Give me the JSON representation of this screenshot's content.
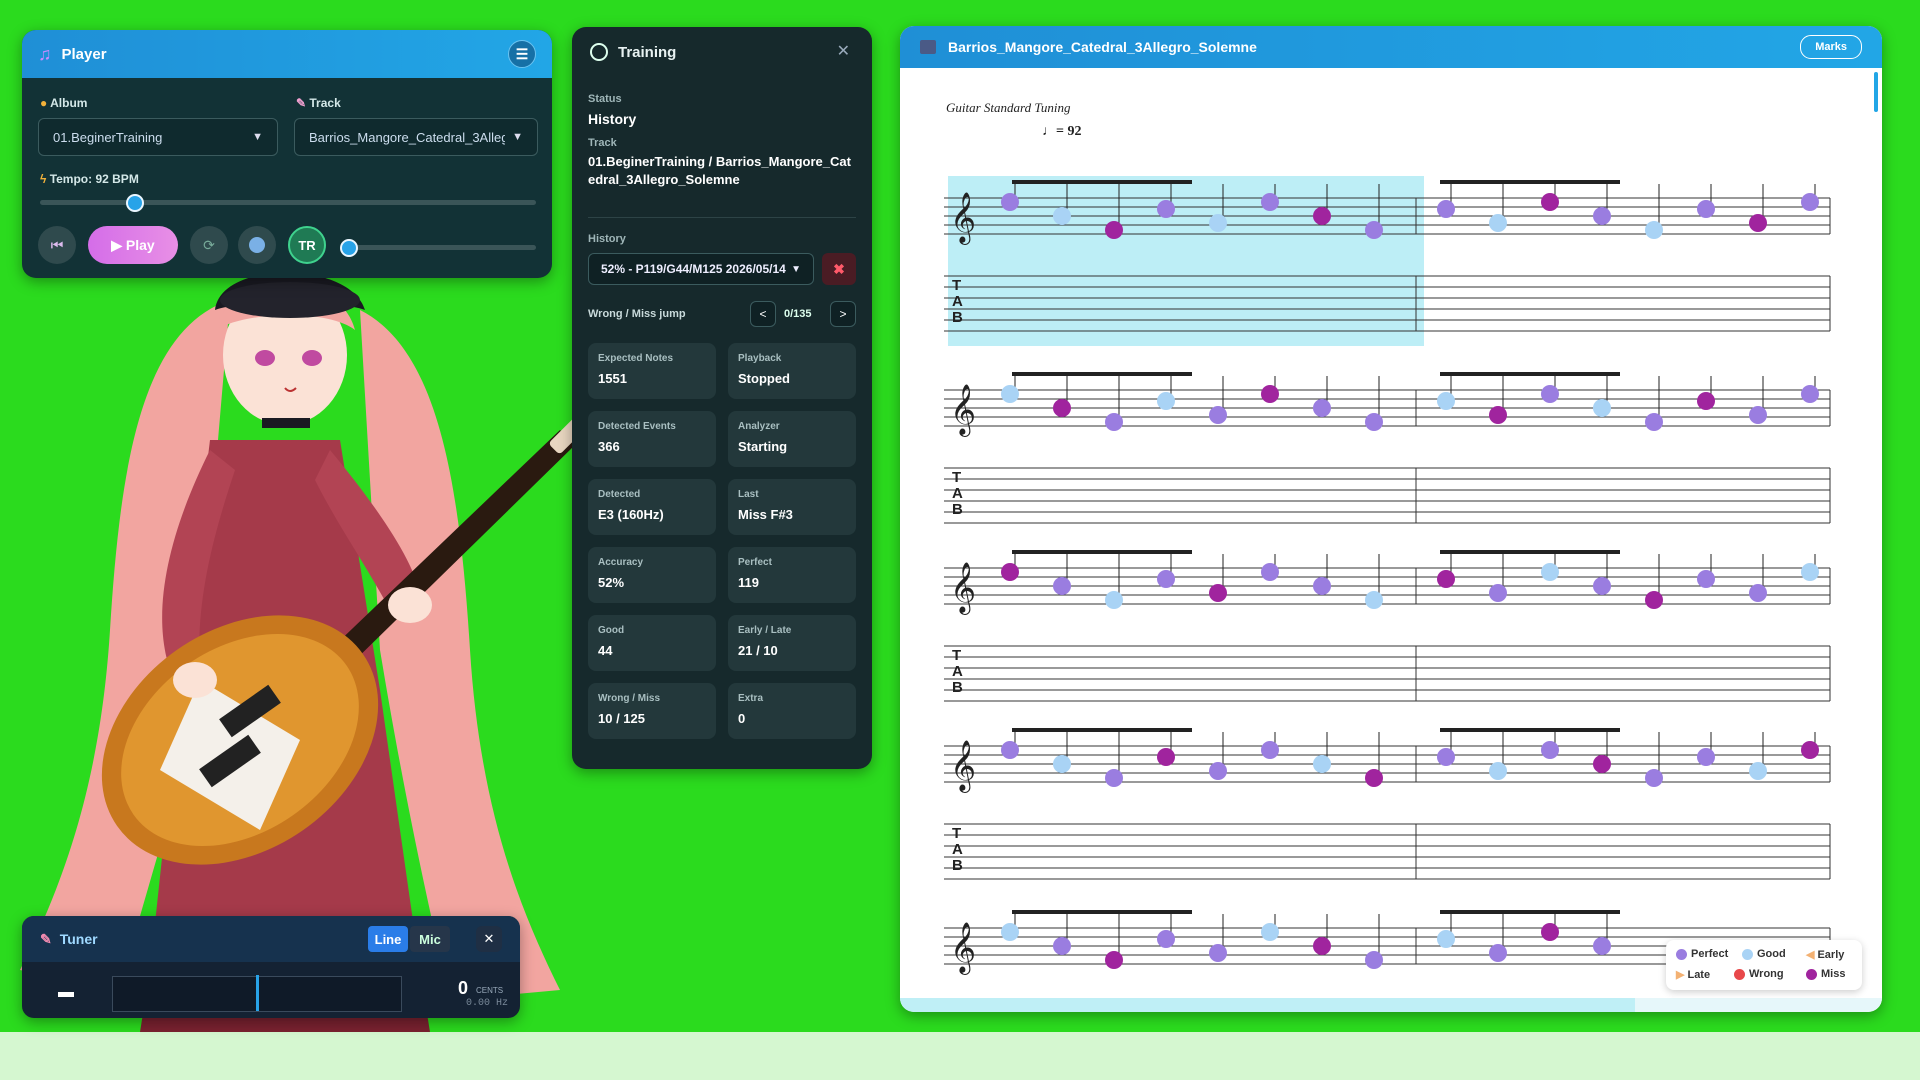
{
  "player": {
    "title": "Player",
    "album_label": "Album",
    "track_label": "Track",
    "album_value": "01.BeginerTraining",
    "track_value": "Barrios_Mangore_Catedral_3Allegro_Solemne",
    "tempo_label": "Tempo: 92 BPM",
    "tempo_slider_value": 92,
    "play_label": "▶ Play",
    "tr_label": "TR"
  },
  "training": {
    "title": "Training",
    "status_label": "Status",
    "status_value": "History",
    "track_label": "Track",
    "track_value": "01.BeginerTraining / Barrios_Mangore_Catedral_3Allegro_Solemne",
    "history_label": "History",
    "history_value": "52% - P119/G44/M125 2026/05/14",
    "jump_label": "Wrong / Miss jump",
    "jump_counter": "0/135",
    "stats": [
      {
        "label": "Expected Notes",
        "value": "1551"
      },
      {
        "label": "Playback",
        "value": "Stopped"
      },
      {
        "label": "Detected Events",
        "value": "366"
      },
      {
        "label": "Analyzer",
        "value": "Starting"
      },
      {
        "label": "Detected",
        "value": "E3 (160Hz)"
      },
      {
        "label": "Last",
        "value": "Miss F#3"
      },
      {
        "label": "Accuracy",
        "value": "52%"
      },
      {
        "label": "Perfect",
        "value": "119"
      },
      {
        "label": "Good",
        "value": "44"
      },
      {
        "label": "Early / Late",
        "value": "21 / 10"
      },
      {
        "label": "Wrong / Miss",
        "value": "10 / 125"
      },
      {
        "label": "Extra",
        "value": "0"
      }
    ]
  },
  "score": {
    "title": "Barrios_Mangore_Catedral_3Allegro_Solemne",
    "marks_label": "Marks",
    "tuning": "Guitar Standard Tuning",
    "tempo_mark": "= 92",
    "legend": [
      {
        "label": "Perfect",
        "color": "#9a7de0"
      },
      {
        "label": "Good",
        "color": "#a9d3f5"
      },
      {
        "label": "Early",
        "color": "#f3b173"
      },
      {
        "label": "Late",
        "color": "#f3b173"
      },
      {
        "label": "Wrong",
        "color": "#e8484a"
      },
      {
        "label": "Miss",
        "color": "#a0249e"
      }
    ]
  },
  "tuner": {
    "title": "Tuner",
    "line_label": "Line",
    "mic_label": "Mic",
    "cents_value": "0",
    "cents_unit": "CENTS",
    "hz_value": "0.00 Hz"
  }
}
